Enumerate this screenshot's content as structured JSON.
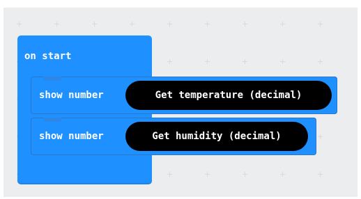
{
  "workspace": {
    "background": "#ecedef",
    "block_color": "#1e90ff",
    "reporter_color": "#000000"
  },
  "blocks": {
    "on_start": {
      "label": "on start"
    },
    "statements": [
      {
        "label": "show number",
        "argument": "Get temperature (decimal)"
      },
      {
        "label": "show number",
        "argument": "Get humidity (decimal)"
      }
    ]
  }
}
